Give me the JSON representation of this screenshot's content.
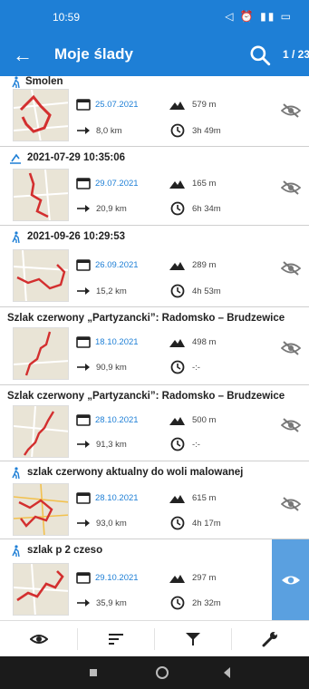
{
  "status_bar": {
    "time": "10:59",
    "icons": "◁ ⏰ ▮▮ ▭"
  },
  "app_bar": {
    "title": "Moje ślady",
    "counter": "1 / 23"
  },
  "tracks": [
    {
      "name": "Smolen",
      "date": "25.07.2021",
      "elevation": "579 m",
      "distance": "8,0 km",
      "duration": "3h 49m",
      "visible": false
    },
    {
      "name": "2021-07-29 10:35:06",
      "date": "29.07.2021",
      "elevation": "165 m",
      "distance": "20,9 km",
      "duration": "6h 34m",
      "visible": false
    },
    {
      "name": "2021-09-26 10:29:53",
      "date": "26.09.2021",
      "elevation": "289 m",
      "distance": "15,2 km",
      "duration": "4h 53m",
      "visible": false
    },
    {
      "name": "Szlak czerwony „Partyzancki”: Radomsko – Brudzewice",
      "date": "18.10.2021",
      "elevation": "498 m",
      "distance": "90,9 km",
      "duration": "-:-",
      "visible": false
    },
    {
      "name": "Szlak czerwony „Partyzancki”: Radomsko – Brudzewice",
      "date": "28.10.2021",
      "elevation": "500 m",
      "distance": "91,3 km",
      "duration": "-:-",
      "visible": false
    },
    {
      "name": "szlak czerwony aktualny do woli malowanej",
      "date": "28.10.2021",
      "elevation": "615 m",
      "distance": "93,0 km",
      "duration": "4h 17m",
      "visible": false
    },
    {
      "name": "szlak p 2 czeso",
      "date": "29.10.2021",
      "elevation": "297 m",
      "distance": "35,9 km",
      "duration": "2h 32m",
      "visible": true
    }
  ],
  "colors": {
    "primary": "#1e7fd6",
    "route": "#d32f2f",
    "active": "#5aa0e0"
  }
}
